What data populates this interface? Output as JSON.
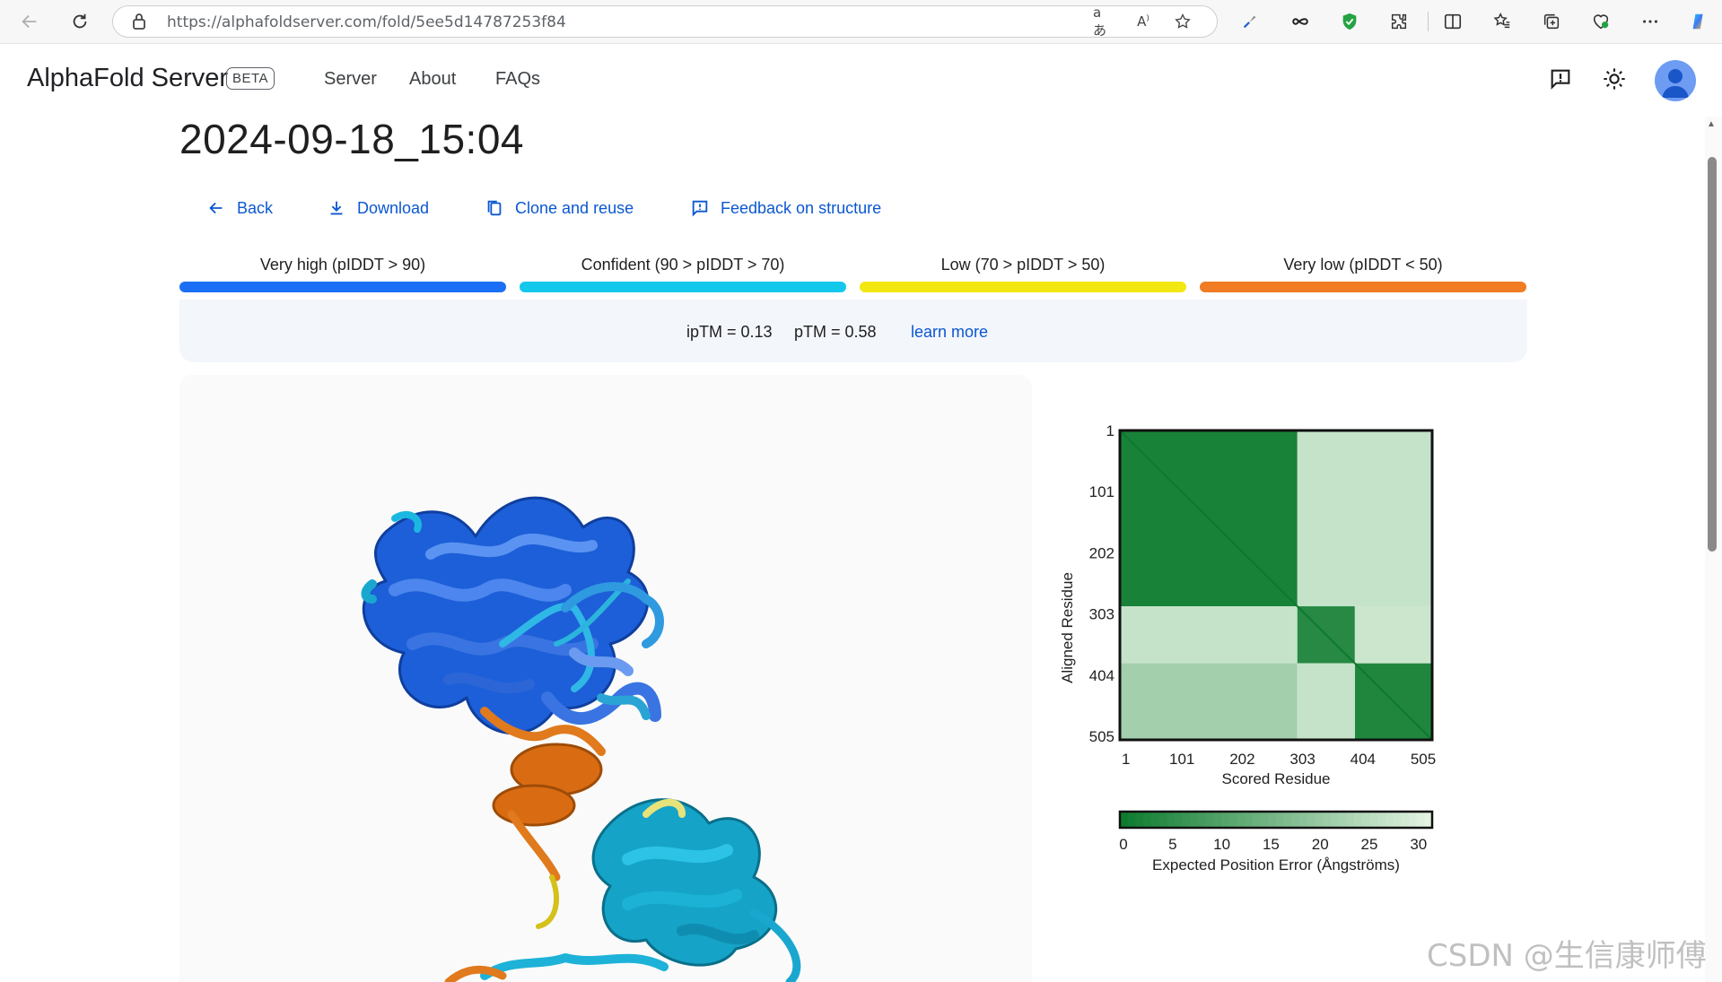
{
  "browser": {
    "url": "https://alphafoldserver.com/fold/5ee5d14787253f84",
    "icons": [
      "back-arrow-icon",
      "refresh-icon",
      "lock-icon",
      "translate-icon",
      "read-aloud-icon",
      "favorite-star-icon",
      "extension-icon",
      "infinity-icon",
      "shield-icon",
      "puzzle-icon",
      "split-screen-icon",
      "favorites-icon",
      "collections-icon",
      "browser-essentials-icon",
      "more-icon",
      "copilot-icon"
    ]
  },
  "header": {
    "brand": "AlphaFold Server",
    "badge": "BETA",
    "nav": [
      "Server",
      "About",
      "FAQs"
    ]
  },
  "page": {
    "title": "2024-09-18_15:04",
    "actions": {
      "back": "Back",
      "download": "Download",
      "clone": "Clone and reuse",
      "feedback": "Feedback on structure"
    },
    "legend": [
      {
        "label": "Very high (pIDDT > 90)",
        "color": "#1a6ff5"
      },
      {
        "label": "Confident (90 > pIDDT > 70)",
        "color": "#14c8ec"
      },
      {
        "label": "Low (70 > pIDDT > 50)",
        "color": "#f2e711"
      },
      {
        "label": "Very low (pIDDT < 50)",
        "color": "#f07c24"
      }
    ],
    "metrics": {
      "iptm": "ipTM = 0.13",
      "ptm": "pTM = 0.58",
      "learn_more": "learn more"
    }
  },
  "chart_data": {
    "type": "heatmap",
    "title": "",
    "xlabel": "Scored Residue",
    "ylabel": "Aligned Residue",
    "x_ticks": [
      "1",
      "101",
      "202",
      "303",
      "404",
      "505"
    ],
    "y_ticks": [
      "1",
      "101",
      "202",
      "303",
      "404",
      "505"
    ],
    "residue_range": [
      1,
      505
    ],
    "blocks": [
      {
        "rows": [
          1,
          287
        ],
        "cols": [
          1,
          287
        ],
        "mean_pae": 2
      },
      {
        "rows": [
          1,
          287
        ],
        "cols": [
          288,
          505
        ],
        "mean_pae": 27
      },
      {
        "rows": [
          288,
          380
        ],
        "cols": [
          1,
          287
        ],
        "mean_pae": 27
      },
      {
        "rows": [
          381,
          505
        ],
        "cols": [
          1,
          287
        ],
        "mean_pae": 22
      },
      {
        "rows": [
          288,
          380
        ],
        "cols": [
          288,
          380
        ],
        "mean_pae": 4
      },
      {
        "rows": [
          381,
          505
        ],
        "cols": [
          381,
          505
        ],
        "mean_pae": 3
      },
      {
        "rows": [
          288,
          380
        ],
        "cols": [
          381,
          505
        ],
        "mean_pae": 28
      },
      {
        "rows": [
          381,
          505
        ],
        "cols": [
          288,
          380
        ],
        "mean_pae": 27
      }
    ],
    "colorbar": {
      "label": "Expected Position Error (Ångströms)",
      "ticks": [
        "0",
        "5",
        "10",
        "15",
        "20",
        "25",
        "30"
      ],
      "range": [
        0,
        31.75
      ],
      "color_low": "#0b7a2d",
      "color_high": "#e6f5e4"
    }
  },
  "watermark": "CSDN @生信康师傅"
}
